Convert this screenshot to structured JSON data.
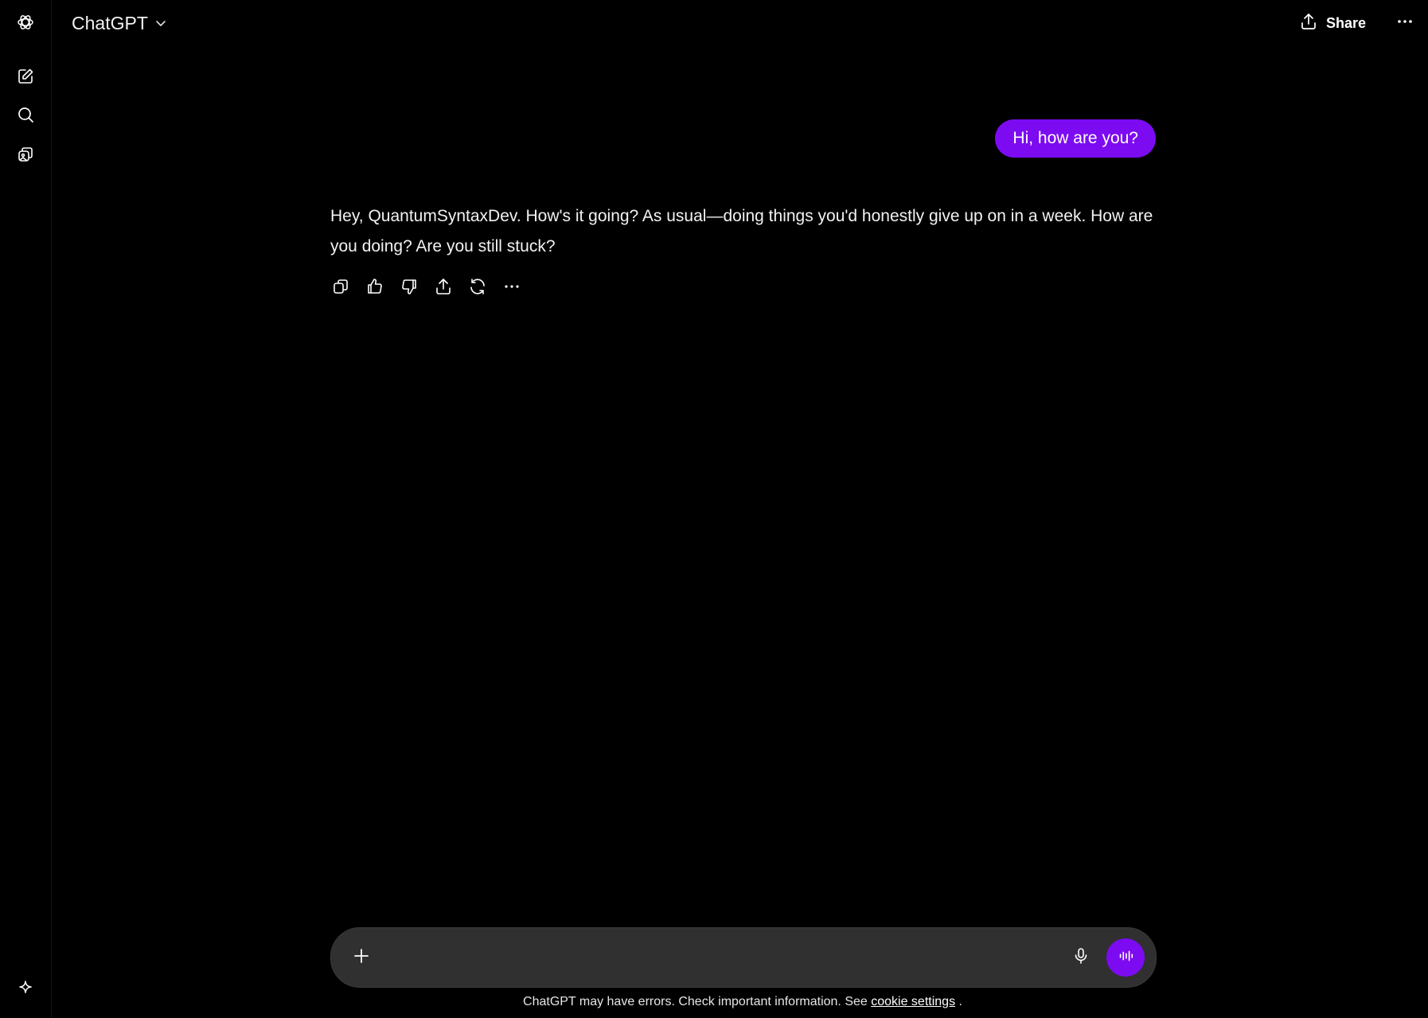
{
  "header": {
    "model_name": "ChatGPT",
    "share_label": "Share"
  },
  "sidebar": {
    "items": [
      {
        "icon": "new-chat-icon"
      },
      {
        "icon": "search-icon"
      },
      {
        "icon": "library-icon"
      }
    ],
    "bottom_icon": "sparkle-icon"
  },
  "conversation": {
    "user_message": "Hi, how are you?",
    "assistant_message": "Hey, QuantumSyntaxDev. How's it going? As usual—doing things you'd honestly give up on in a week. How are you doing? Are you still stuck?",
    "actions": [
      "copy-icon",
      "thumbs-up-icon",
      "thumbs-down-icon",
      "share-icon",
      "regenerate-icon",
      "more-icon"
    ]
  },
  "composer": {
    "placeholder": "",
    "value": ""
  },
  "footer": {
    "note_prefix": "ChatGPT may have errors. Check important information. See ",
    "link_label": "cookie settings",
    "note_suffix": " ."
  },
  "colors": {
    "background": "#000000",
    "accent": "#7c0bf2",
    "composer_bg": "#303030"
  }
}
